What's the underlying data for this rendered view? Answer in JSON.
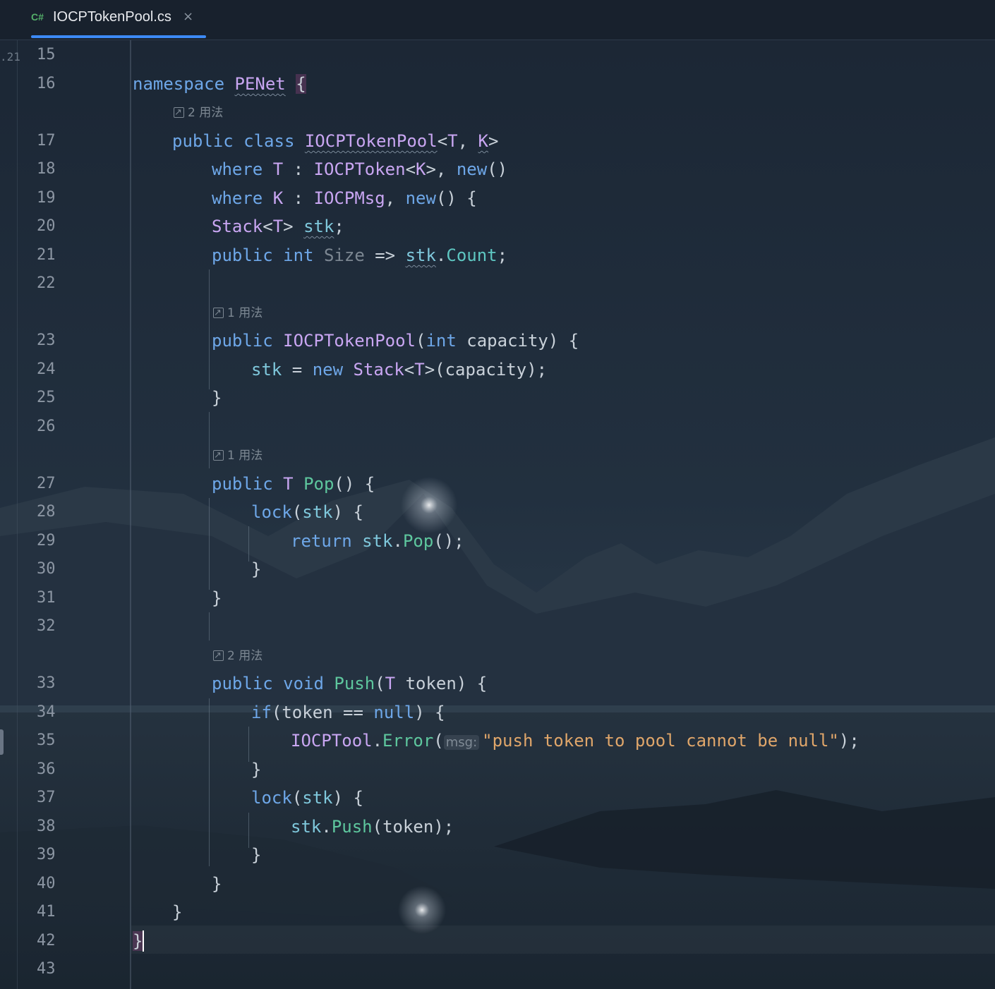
{
  "tab": {
    "language_badge": "C#",
    "title": "IOCPTokenPool.cs",
    "close_glyph": "×"
  },
  "left_strip": {
    "revision_label": ".21"
  },
  "line_numbers": [
    "15",
    "16",
    "17",
    "18",
    "19",
    "20",
    "21",
    "22",
    "23",
    "24",
    "25",
    "26",
    "27",
    "28",
    "29",
    "30",
    "31",
    "32",
    "33",
    "34",
    "35",
    "36",
    "37",
    "38",
    "39",
    "40",
    "41",
    "42",
    "43"
  ],
  "usage_hints": {
    "class": "2 用法",
    "ctor": "1 用法",
    "pop": "1 用法",
    "push": "2 用法"
  },
  "inline_param_hint": "msg:",
  "code": {
    "kw_namespace": "namespace",
    "ns_name": "PENet",
    "kw_public": "public",
    "kw_class": "class",
    "kw_where": "where",
    "kw_new": "new",
    "kw_int": "int",
    "kw_lock": "lock",
    "kw_return": "return",
    "kw_void": "void",
    "kw_if": "if",
    "kw_null": "null",
    "class_name": "IOCPTokenPool",
    "tp_T": "T",
    "tp_K": "K",
    "type_token": "IOCPToken",
    "type_msg": "IOCPMsg",
    "type_stack": "Stack",
    "type_tool": "IOCPTool",
    "field_stk": "stk",
    "prop_size": "Size",
    "prop_count": "Count",
    "param_capacity": "capacity",
    "param_token": "token",
    "method_pop": "Pop",
    "method_push": "Push",
    "method_error": "Error",
    "string_error": "\"push token to pool cannot be null\""
  },
  "colors": {
    "keyword": "#6ea7e8",
    "type": "#c9a6f2",
    "method": "#5ec79e",
    "string": "#e0a66a",
    "accent": "#3d8af5"
  }
}
